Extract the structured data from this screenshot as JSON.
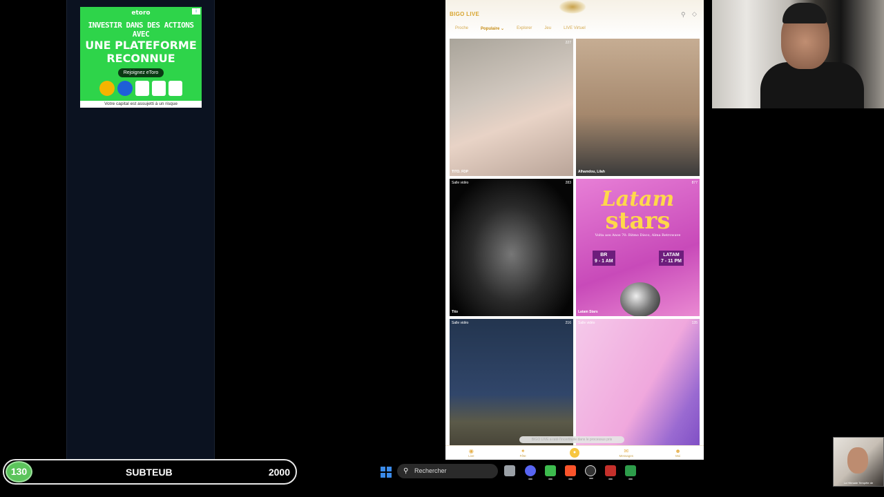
{
  "ad": {
    "brand": "etoro",
    "headline_small": "INVESTIR DANS DES ACTIONS AVEC",
    "headline_big_1": "UNE PLATEFORME",
    "headline_big_2": "RECONNUE",
    "cta": "Rejoignez eToro",
    "disclaimer": "Votre capital est assujetti à un risque"
  },
  "bigo": {
    "brand": "BIGO LIVE",
    "tabs": [
      "Proche",
      "Populaire",
      "Explorer",
      "Jeu",
      "LIVE Virtuel"
    ],
    "active_tab": "Populaire",
    "tiles": [
      {
        "tag": "",
        "viewers": "227",
        "name": "TITO. FDP"
      },
      {
        "tag": "",
        "viewers": "",
        "name": "Alhamdou, Lilah"
      },
      {
        "tag": "Salle vidéo",
        "viewers": "283",
        "name": "Tito"
      },
      {
        "tag": "",
        "viewers": "877",
        "name": "Latam Stars"
      },
      {
        "tag": "Salle vidéo",
        "viewers": "216",
        "name": ""
      },
      {
        "tag": "Salle vidéo",
        "viewers": "135",
        "name": ""
      }
    ],
    "latam": {
      "title1": "Latam",
      "title2": "stars",
      "sub": "Volta aos Anos 70: Ritmo Disco, Alma Retrowave",
      "br_label": "BR",
      "br_time": "9 - 1 AM",
      "latam_label": "LATAM",
      "latam_time": "7 - 11 PM"
    },
    "toast": "BIGO LIVE a raté l'incertitude dans le processus pris",
    "nav": [
      "Live",
      "Fête",
      "",
      "Messages",
      "Moi"
    ]
  },
  "subbar": {
    "level": "130",
    "name": "SUBTEUB",
    "goal": "2000"
  },
  "taskbar": {
    "search_placeholder": "Rechercher"
  },
  "minicam": {
    "caption": "La Hitmade Tempête de"
  }
}
